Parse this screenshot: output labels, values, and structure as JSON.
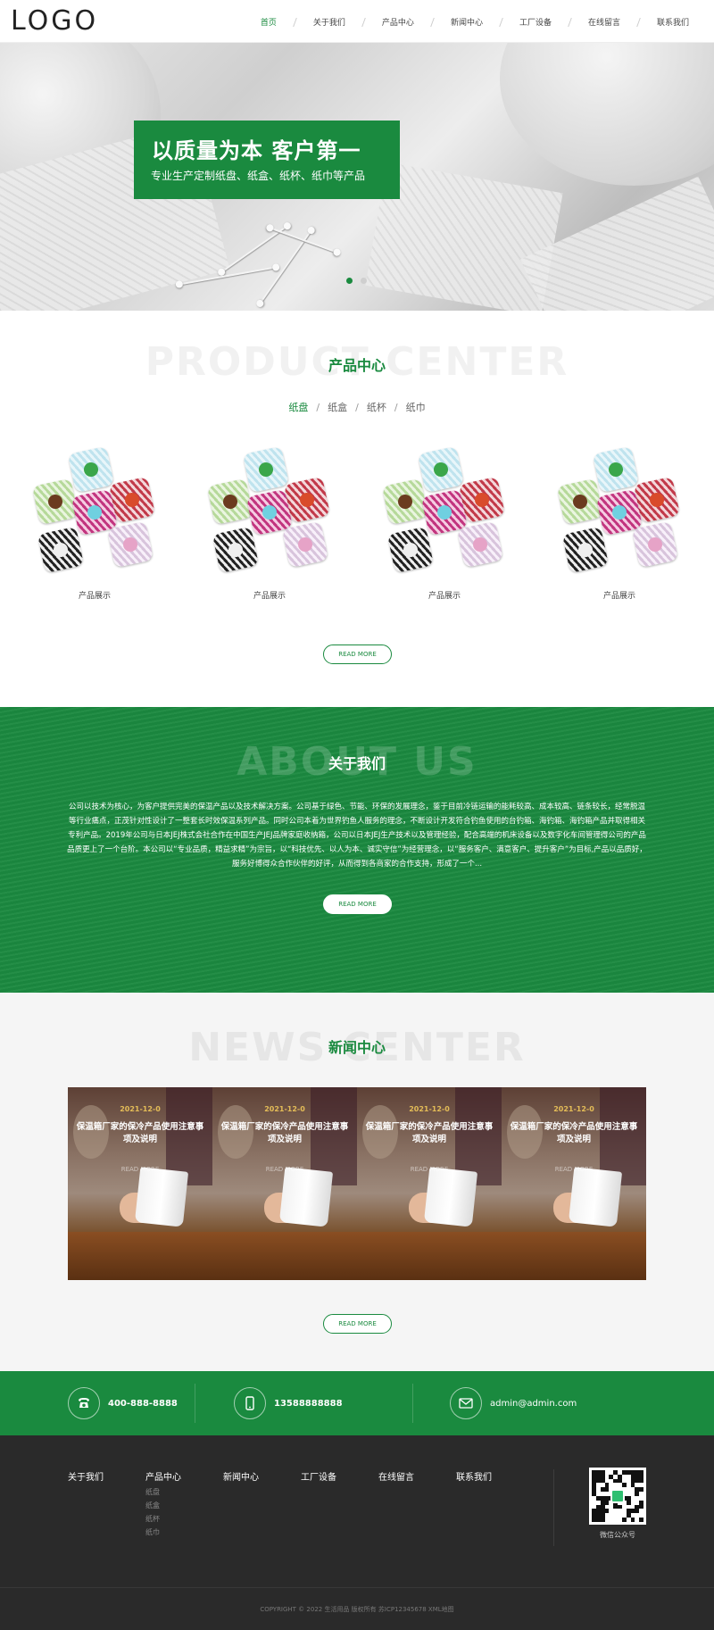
{
  "header": {
    "logo": "LOGO",
    "nav": [
      {
        "label": "首页",
        "active": true
      },
      {
        "label": "关于我们",
        "active": false
      },
      {
        "label": "产品中心",
        "active": false
      },
      {
        "label": "新闻中心",
        "active": false
      },
      {
        "label": "工厂设备",
        "active": false
      },
      {
        "label": "在线留言",
        "active": false
      },
      {
        "label": "联系我们",
        "active": false
      }
    ]
  },
  "banner": {
    "title": "以质量为本  客户第一",
    "subtitle": "专业生产定制纸盘、纸盒、纸杯、纸巾等产品",
    "slide_count": 2,
    "active_slide": 1
  },
  "products": {
    "bg_title": "PRODUCT CENTER",
    "title": "产品中心",
    "tabs": [
      "纸盘",
      "纸盒",
      "纸杯",
      "纸巾"
    ],
    "active_tab": 0,
    "items": [
      {
        "label": "产品展示"
      },
      {
        "label": "产品展示"
      },
      {
        "label": "产品展示"
      },
      {
        "label": "产品展示"
      }
    ],
    "more_label": "READ MORE"
  },
  "about": {
    "bg_title": "ABOUT US",
    "title": "关于我们",
    "text": "公司以技术为核心，为客户提供完美的保温产品以及技术解决方案。公司基于绿色、节能、环保的发展理念，鉴于目前冷链运输的能耗较高、成本较高、链条较长，经常脱温等行业痛点，正茂针对性设计了一整套长时效保温系列产品。同时公司本着为世界钓鱼人服务的理念，不断设计开发符合钓鱼使用的台钓箱、海钓箱、海钓箱产品并取得相关专利产品。2019年公司与日本JEJ株式会社合作在中国生产JEJ品牌家庭收纳箱，公司以日本JEJ生产技术以及管理经验，配合高端的机床设备以及数字化车间管理得公司的产品品质更上了一个台阶。本公司以“专业品质，精益求精”为宗旨，以“科技优先、以人为本、诚实守信”为经营理念，以“服务客户、满意客户、提升客户”为目标,产品以品质好，服务好博得众合作伙伴的好评，从而得到各商家的合作支持，形成了一个...",
    "more_label": "READ MORE"
  },
  "news": {
    "bg_title": "NEWS CENTER",
    "title": "新闻中心",
    "items": [
      {
        "date": "2021-12-0",
        "title": "保温箱厂家的保冷产品使用注意事项及说明",
        "more": "READ MORE"
      },
      {
        "date": "2021-12-0",
        "title": "保温箱厂家的保冷产品使用注意事项及说明",
        "more": "READ MORE"
      },
      {
        "date": "2021-12-0",
        "title": "保温箱厂家的保冷产品使用注意事项及说明",
        "more": "READ MORE"
      },
      {
        "date": "2021-12-0",
        "title": "保温箱厂家的保冷产品使用注意事项及说明",
        "more": "READ MORE"
      }
    ],
    "more_label": "READ MORE"
  },
  "contact": {
    "phone": "400-888-8888",
    "mobile": "13588888888",
    "email": "admin@admin.com",
    "phone_icon": "phone-icon",
    "mobile_icon": "mobile-icon",
    "email_icon": "mail-icon"
  },
  "footer": {
    "columns": [
      {
        "label": "关于我们",
        "subs": []
      },
      {
        "label": "产品中心",
        "subs": [
          "纸盘",
          "纸盒",
          "纸杯",
          "纸巾"
        ]
      },
      {
        "label": "新闻中心",
        "subs": []
      },
      {
        "label": "工厂设备",
        "subs": []
      },
      {
        "label": "在线留言",
        "subs": []
      },
      {
        "label": "联系我们",
        "subs": []
      }
    ],
    "qr_label": "微信公众号",
    "copyright": "COPYRIGHT © 2022 生活用品 版权所有    苏ICP12345678    XML地图"
  },
  "colors": {
    "brand_green": "#1a8a3f",
    "footer_bg": "#2a2a2a"
  }
}
